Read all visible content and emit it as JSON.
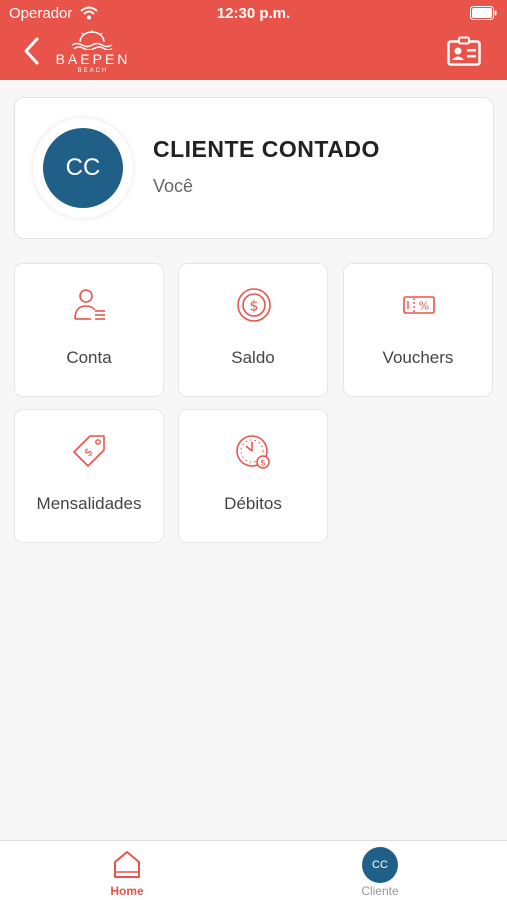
{
  "status_bar": {
    "carrier": "Operador",
    "time": "12:30 p.m."
  },
  "header": {
    "logo_text": "BAEPEN",
    "logo_sub": "BEACH"
  },
  "profile": {
    "initials": "CC",
    "name": "CLIENTE CONTADO",
    "role": "Você"
  },
  "menu": {
    "tiles": [
      {
        "label": "Conta",
        "icon": "user-list-icon"
      },
      {
        "label": "Saldo",
        "icon": "dollar-coin-icon"
      },
      {
        "label": "Vouchers",
        "icon": "percent-ticket-icon"
      },
      {
        "label": "Mensalidades",
        "icon": "price-tag-icon"
      },
      {
        "label": "Débitos",
        "icon": "clock-money-icon"
      }
    ]
  },
  "tab_bar": {
    "items": [
      {
        "label": "Home",
        "icon": "home-icon",
        "active": true
      },
      {
        "label": "Cliente",
        "icon": "avatar",
        "initials": "CC",
        "active": false
      }
    ]
  },
  "colors": {
    "brand": "#e9544a",
    "avatar": "#1f5f88",
    "background": "#f7f7f7"
  }
}
